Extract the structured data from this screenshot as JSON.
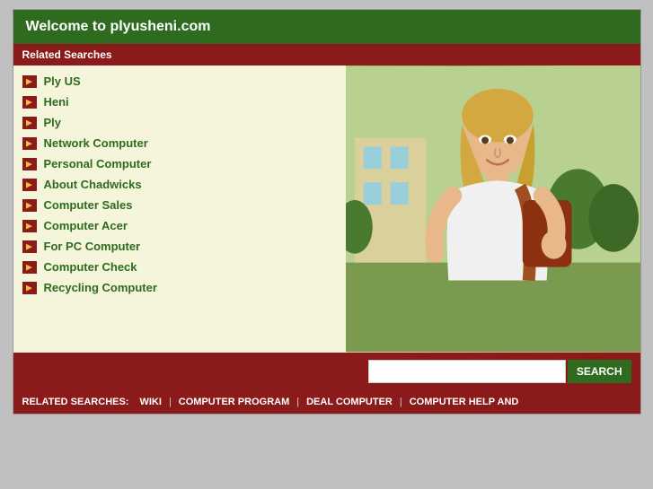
{
  "header": {
    "title": "Welcome to plyusheni.com"
  },
  "sidebar": {
    "label": "Related Searches",
    "items": [
      {
        "id": "ply-us",
        "label": "Ply US"
      },
      {
        "id": "heni",
        "label": "Heni"
      },
      {
        "id": "ply",
        "label": "Ply"
      },
      {
        "id": "network-computer",
        "label": "Network Computer"
      },
      {
        "id": "personal-computer",
        "label": "Personal Computer"
      },
      {
        "id": "about-chadwicks",
        "label": "About Chadwicks"
      },
      {
        "id": "computer-sales",
        "label": "Computer Sales"
      },
      {
        "id": "computer-acer",
        "label": "Computer Acer"
      },
      {
        "id": "for-pc-computer",
        "label": "For PC Computer"
      },
      {
        "id": "computer-check",
        "label": "Computer Check"
      },
      {
        "id": "recycling-computer",
        "label": "Recycling Computer"
      }
    ]
  },
  "search": {
    "placeholder": "",
    "button_label": "SEARCH"
  },
  "bottom_bar": {
    "label": "RELATED SEARCHES:",
    "links": [
      {
        "id": "wiki",
        "label": "WIKI"
      },
      {
        "id": "computer-program",
        "label": "COMPUTER PROGRAM"
      },
      {
        "id": "deal-computer",
        "label": "DEAL COMPUTER"
      },
      {
        "id": "computer-help-and",
        "label": "COMPUTER HELP AND"
      }
    ]
  }
}
